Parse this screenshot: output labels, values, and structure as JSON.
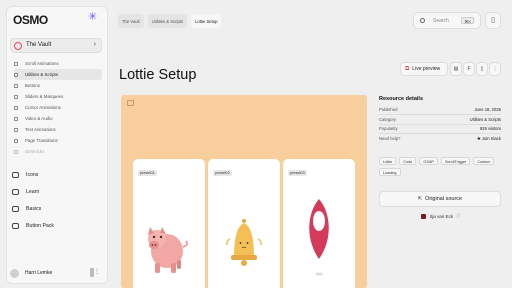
{
  "sidebar": {
    "logo": "OSMO",
    "vault_label": "The Vault",
    "nav_items": [
      {
        "label": "Scroll Animations"
      },
      {
        "label": "Utilities & Scripts"
      },
      {
        "label": "Buttons"
      },
      {
        "label": "Sliders & Marquees"
      },
      {
        "label": "Cursor Animations"
      },
      {
        "label": "Video & Audio"
      },
      {
        "label": "Text Animations"
      },
      {
        "label": "Page Transitions"
      },
      {
        "label": "Gimmicks"
      }
    ],
    "main_items": [
      {
        "label": "Icons",
        "icon": "icons-icon"
      },
      {
        "label": "Learn",
        "icon": "learn-icon"
      },
      {
        "label": "Basics",
        "icon": "basics-icon"
      },
      {
        "label": "Button Pack",
        "icon": "button-pack-icon"
      }
    ],
    "user_name": "Harri Lemke"
  },
  "header": {
    "breadcrumbs": [
      "The Vault",
      "Utilities & Scripts",
      "Lottie Setup"
    ],
    "search_placeholder": "Search",
    "search_shortcut": "⌘K"
  },
  "page": {
    "title": "Lottie Setup",
    "live_preview_label": "Live preview",
    "cards": [
      {
        "label": "preset01"
      },
      {
        "label": "preset02"
      },
      {
        "label": "preset03"
      }
    ]
  },
  "resource": {
    "heading": "Resource details",
    "rows": [
      {
        "key": "Published",
        "value": "June 18, 2025"
      },
      {
        "key": "Category",
        "value": "Utilities & Scripts"
      },
      {
        "key": "Popularity",
        "value": "929 visitors"
      },
      {
        "key": "Need help?",
        "value": "Join Slack"
      }
    ],
    "tags": [
      "Lottie",
      "Code",
      "GSAP",
      "ScrollTrigger",
      "Custom",
      "Loading"
    ],
    "original_source_label": "Original source",
    "author": "Ilja van Eck"
  },
  "colors": {
    "preview_bg": "#f8cf9c",
    "accent": "#6b5cff",
    "pin_red": "#d43a5a"
  }
}
